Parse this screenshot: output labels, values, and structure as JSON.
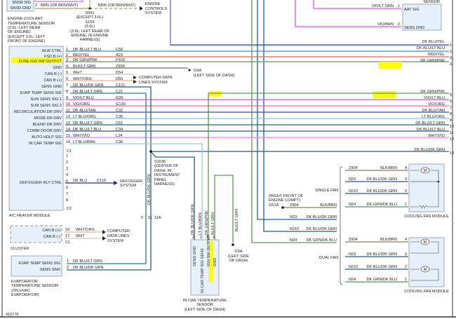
{
  "figure_id": "410776",
  "ect_sensor": {
    "pin_sig": "SNSR SIG",
    "pin_gnd": "SNSR GND",
    "pin_gnd_num": "2",
    "wire": "BRN (OR BRN/WHT)",
    "label": [
      "ENGINE COOLANT",
      "TEMPERATURE SENSOR",
      "(3.6L: LEFT REAR",
      "OF ENGINE)",
      "(EXCEPT 3.6L: LEFT",
      "FRONT OF ENGINE)"
    ]
  },
  "splice_s991": [
    "S991",
    "(EXCEPT 3.6L)",
    "S155",
    "(3.6L)",
    "(3.6L: LEFT REAR OF",
    "ENGINE, IN ENGINE",
    "HARNESS)"
  ],
  "engine_wire": "BRN (OR BRN/WHT)",
  "engine_controls": [
    "ENGINE",
    "CONTROLS",
    "SYSTEM"
  ],
  "aat_sensor": {
    "title": "SENSOR",
    "pin1": {
      "num": "1",
      "name": "AAT SIG",
      "wire": "VIO/LT GRN"
    },
    "pin2": {
      "num": "2",
      "name": "SENS GND",
      "wire": "VIO/BRN"
    }
  },
  "module": {
    "name": "A/C HEATER MODULE",
    "c1": "C1",
    "c2": "C2",
    "c1_pins": [
      {
        "num": "1",
        "name": "BLW CTRL",
        "wire": "DK BLU/LT BLU",
        "circuit": "C56",
        "color": "#3a8fd8"
      },
      {
        "num": "2",
        "name": "FSD B (+)",
        "wire": "RED/YEL",
        "circuit": "A23",
        "color": "#ff5a4a"
      },
      {
        "num": "3",
        "name": "FUSE IGN SW OUTPUT",
        "wire": "DK GRN/PNK",
        "circuit": "F500",
        "color": "#5a9a50",
        "highlight": true
      },
      {
        "num": "4",
        "name": "GND",
        "wire": "BLK/LT GRN",
        "circuit": "Z909",
        "color": "#607060"
      },
      {
        "num": "5",
        "name": "CAN B (-)",
        "wire": "WHT",
        "circuit": "D54",
        "color": "#c8c8c8"
      },
      {
        "num": "6",
        "name": "CAN B (+)",
        "wire": "WHT/ORG",
        "circuit": "D55",
        "color": "#f0b080"
      },
      {
        "num": "7",
        "name": "SENS GND",
        "wire": "DK BLU/DK GRN",
        "circuit": "C121",
        "color": "#2a5a80"
      },
      {
        "num": "8",
        "name": "EVAP TEMP SENS SIG",
        "wire": "DK BLU/LT GRN",
        "circuit": "C21",
        "color": "#2a6a90"
      },
      {
        "num": "9",
        "name": "SUN SENS SIG 1",
        "wire": "VIO/LT BLU",
        "circuit": "G39",
        "color": "#e050e8"
      },
      {
        "num": "10",
        "name": "SUN SENS SIG 2",
        "wire": "VIO/ORG",
        "circuit": "G139",
        "color": "#f060b0"
      },
      {
        "num": "11",
        "name": "RECIRCULATION DR DRV",
        "wire": "DK BLU/TAN",
        "circuit": "C32",
        "color": "#34508a"
      },
      {
        "num": "12",
        "name": "MODE DR DRV",
        "wire": "LT BLU/ORG",
        "circuit": "C35",
        "color": "#70d8d0"
      },
      {
        "num": "13",
        "name": "BLEND DR DRV",
        "wire": "DK BLU/LT GRN",
        "circuit": "C61",
        "color": "#2a6a70"
      },
      {
        "num": "14",
        "name": "COMM DOOR DRV",
        "wire": "DK BLU/LT BLU",
        "circuit": "C34",
        "color": "#2a5a90"
      },
      {
        "num": "15",
        "name": "AUTO HDLP SIG",
        "wire": "WHT/VIO",
        "circuit": "L24",
        "color": "#f080f0"
      },
      {
        "num": "16",
        "name": "IN CAR TEMP SIG",
        "wire": "LT BLU/BRN",
        "circuit": "C36",
        "color": "#90d0e0"
      }
    ],
    "c2_pins": [
      {
        "num": "1"
      },
      {
        "num": "2"
      },
      {
        "num": "3"
      },
      {
        "num": "4"
      },
      {
        "num": "5",
        "name": "DEFOGGER RLY CTRL",
        "wire": "DK BLU",
        "circuit": "C115"
      },
      {
        "num": "6"
      },
      {
        "num": "7"
      },
      {
        "num": "8"
      }
    ]
  },
  "defogger": [
    "DEFOGGER",
    "SYSTEM"
  ],
  "computer_data_lines": [
    "COMPUTER DATA",
    "LINES SYSTEM"
  ],
  "g9a_top": [
    "G9A",
    "(LEFT SIDE OF DASH)"
  ],
  "right_wires": [
    {
      "num": "1",
      "wire": "DK BLU/YEL"
    },
    {
      "num": "2",
      "wire": "DK BLU/LT BLU"
    },
    {
      "num": "3",
      "wire": "RED/YEL"
    },
    {
      "num": "4",
      "wire": "DK GRN/PNK"
    },
    {
      "num": "5",
      "wire": "DK GRN/PNK"
    },
    {
      "num": "6",
      "wire": "VIO/LT BLU"
    },
    {
      "num": "7",
      "wire": "VIO/ORG"
    },
    {
      "num": "8",
      "wire": "DK BLU/TAN"
    },
    {
      "num": "9",
      "wire": "LT BLU/ORG"
    },
    {
      "num": "10",
      "wire": "DK BLU/LT GRN"
    },
    {
      "num": "11",
      "wire": "DK BLU/LT BLU"
    },
    {
      "num": "12",
      "wire": "WHT/VIO"
    },
    {
      "num": "13",
      "wire": "DK BLU/DK GRN"
    }
  ],
  "s1636": {
    "label": [
      "S1636",
      "(CENTER OF",
      "DASH, IN",
      "INSTRUMENT",
      "PANEL",
      "HARNESS)"
    ],
    "wire": "DK BLU/DK GRN",
    "connectors": [
      "6",
      "11",
      "11A"
    ]
  },
  "cluster": {
    "name": "CLUSTER",
    "connector": "C1",
    "pins": [
      {
        "num": "16",
        "name": "CAN B (+)",
        "wire": "WHT/ORG"
      },
      {
        "num": "17",
        "name": "CAN B (-)",
        "wire": "WHT"
      }
    ],
    "target": [
      "COMPUTER",
      "DATA LINES",
      "SYSTEM"
    ]
  },
  "evap_sensor": {
    "pins": [
      {
        "num": "1",
        "name": "EVAP TEMP SENS SIG",
        "wire": "DK BLU/LT GRN"
      },
      {
        "num": "2",
        "name": "SENS GND",
        "wire": "DK BLU/DK GRN"
      }
    ],
    "label": [
      "EVAPORATOR",
      "TEMPERATURE SENSOR",
      "(ON HVAC",
      "EVAPORATOR)"
    ]
  },
  "in_car_sensor": {
    "pins": [
      {
        "num": "2",
        "name": "SENS GND",
        "wire": "DK BLU/DK GRN"
      },
      {
        "num": "1",
        "name": "IN CAR TEMP SIG SENS",
        "wire": "LT BLU/BRN"
      },
      {
        "num": "3",
        "name": "IGN SW OUTPUT",
        "wire": "DK GRN/PNK",
        "highlight": true
      },
      {
        "num": "4",
        "name": "GND",
        "wire": "BLK/LT GRN"
      }
    ],
    "label": [
      "IN CAR TEMPERATURE",
      "SENSOR",
      "(LEFT SIDE OF DASH)"
    ],
    "ground_wire": "BLK/LT GRN",
    "ground": [
      "G9A",
      "(LEFT SIDE",
      "OF DASH)"
    ]
  },
  "fans": {
    "ground": [
      "(RIGHT FRONT OF",
      "ENGINE COMPT)",
      "G51A"
    ],
    "feed": [
      {
        "circuit": "Z904",
        "wire": "BLK/BRN"
      },
      {
        "circuit": "N23",
        "wire": "DK BLU/DK GRN"
      },
      {
        "circuit": "N210",
        "wire": "DK BLU/DK GRN"
      },
      {
        "circuit": "N24",
        "wire": "DK GRN/DK BLU"
      }
    ],
    "single_label": "SINGLE FAN",
    "dual_label": "DUAL FAN",
    "module_name": "COOLING FAN MODULE",
    "motor_symbol": "M",
    "pins": [
      {
        "num": "4",
        "circuit": "Z904",
        "wire": "BLK/BRN",
        "color": "#8a7a60"
      },
      {
        "num": "3",
        "circuit": "N23",
        "wire": "DK BLU/DK GRN",
        "color": "#2a5a90"
      },
      {
        "num": "2",
        "circuit": "N210",
        "wire": "DK BLU/DK GRN",
        "color": "#2a5a90"
      },
      {
        "num": "1",
        "circuit": "N24",
        "wire": "DK GRN/DK BLU",
        "color": "#40a050"
      }
    ]
  },
  "highlight_color": "#ffff00"
}
